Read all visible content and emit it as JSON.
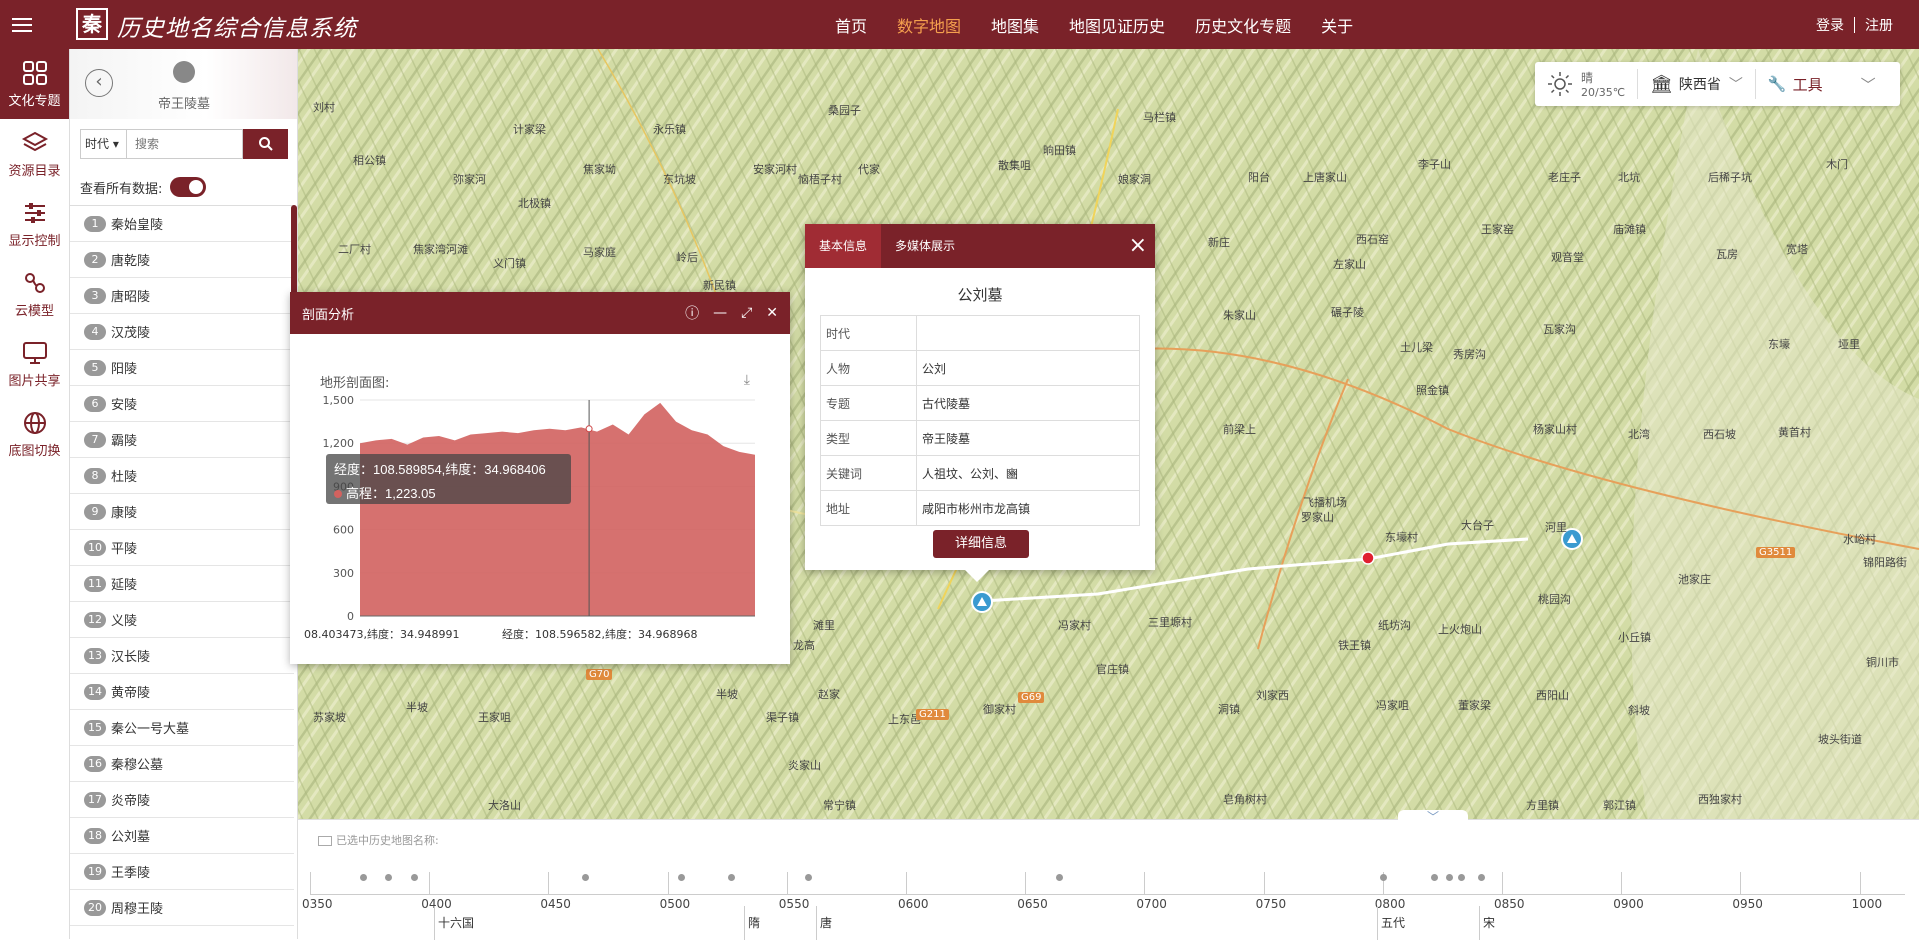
{
  "app": {
    "title": "历史地名综合信息系统",
    "logo_char": "秦"
  },
  "nav": {
    "items": [
      "首页",
      "数字地图",
      "地图集",
      "地图见证历史",
      "历史文化专题",
      "关于"
    ],
    "active": "数字地图"
  },
  "auth": {
    "login": "登录",
    "register": "注册"
  },
  "sidenav": {
    "items": [
      {
        "label": "文化专题",
        "icon": "grid-icon",
        "active": true
      },
      {
        "label": "资源目录",
        "icon": "layers-icon"
      },
      {
        "label": "显示控制",
        "icon": "sliders-icon"
      },
      {
        "label": "云模型",
        "icon": "cloud-model-icon"
      },
      {
        "label": "图片共享",
        "icon": "image-share-icon"
      },
      {
        "label": "底图切换",
        "icon": "globe-icon"
      }
    ]
  },
  "panel": {
    "title": "帝王陵墓",
    "era_select": "时代",
    "search_placeholder": "搜索",
    "view_all_label": "查看所有数据:",
    "items": [
      {
        "n": "1",
        "name": "秦始皇陵"
      },
      {
        "n": "2",
        "name": "唐乾陵"
      },
      {
        "n": "3",
        "name": "唐昭陵"
      },
      {
        "n": "4",
        "name": "汉茂陵"
      },
      {
        "n": "5",
        "name": "阳陵"
      },
      {
        "n": "6",
        "name": "安陵"
      },
      {
        "n": "7",
        "name": "霸陵"
      },
      {
        "n": "8",
        "name": "杜陵"
      },
      {
        "n": "9",
        "name": "康陵"
      },
      {
        "n": "10",
        "name": "平陵"
      },
      {
        "n": "11",
        "name": "延陵"
      },
      {
        "n": "12",
        "name": "义陵"
      },
      {
        "n": "13",
        "name": "汉长陵"
      },
      {
        "n": "14",
        "name": "黄帝陵"
      },
      {
        "n": "15",
        "name": "秦公一号大墓"
      },
      {
        "n": "16",
        "name": "秦穆公墓"
      },
      {
        "n": "17",
        "name": "炎帝陵"
      },
      {
        "n": "18",
        "name": "公刘墓"
      },
      {
        "n": "19",
        "name": "王季陵"
      },
      {
        "n": "20",
        "name": "周穆王陵"
      }
    ]
  },
  "weather": {
    "condition": "晴",
    "temp": "20/35℃",
    "province": "陕西省",
    "tools": "工具"
  },
  "profile": {
    "title": "剖面分析",
    "subtitle": "地形剖面图:",
    "tooltip_coord": "经度：108.589854,纬度：34.968406",
    "tooltip_height": "高程：1,223.05",
    "x_start": "08.403473,纬度：34.948991",
    "x_mid": "经度：108.596582,纬度：34.968968"
  },
  "chart_data": {
    "type": "area",
    "title": "地形剖面图:",
    "ylim": [
      0,
      1500
    ],
    "yticks": [
      "0",
      "300",
      "600",
      "900",
      "1,200",
      "1,500"
    ],
    "x": [
      0,
      4,
      8,
      12,
      16,
      20,
      24,
      28,
      32,
      36,
      40,
      44,
      48,
      52,
      56,
      60,
      64,
      68,
      72,
      76,
      80,
      84,
      88,
      92,
      96,
      100
    ],
    "values": [
      1200,
      1220,
      1230,
      1190,
      1240,
      1250,
      1220,
      1260,
      1270,
      1280,
      1270,
      1290,
      1300,
      1290,
      1310,
      1280,
      1330,
      1260,
      1400,
      1480,
      1350,
      1290,
      1260,
      1180,
      1140,
      1120
    ],
    "color": "#d2625f"
  },
  "popup": {
    "tabs": [
      "基本信息",
      "多媒体展示"
    ],
    "title": "公刘墓",
    "rows": [
      {
        "k": "时代",
        "v": ""
      },
      {
        "k": "人物",
        "v": "公刘"
      },
      {
        "k": "专题",
        "v": "古代陵墓"
      },
      {
        "k": "类型",
        "v": "帝王陵墓"
      },
      {
        "k": "关键词",
        "v": "人祖坟、公刘、豳"
      },
      {
        "k": "地址",
        "v": "咸阳市彬州市龙高镇"
      }
    ],
    "button": "详细信息"
  },
  "map_labels": [
    [
      "计家梁",
      215,
      22
    ],
    [
      "永乐镇",
      355,
      22
    ],
    [
      "桑园子",
      530,
      3
    ],
    [
      "马栏镇",
      845,
      10
    ],
    [
      "刘村",
      15,
      0
    ],
    [
      "相公镇",
      55,
      53
    ],
    [
      "弥家河",
      155,
      72
    ],
    [
      "东坑坡",
      365,
      72
    ],
    [
      "焦家坳",
      285,
      62
    ],
    [
      "安家河村",
      455,
      62
    ],
    [
      "代家",
      560,
      62
    ],
    [
      "散集咀",
      700,
      58
    ],
    [
      "晌田镇",
      745,
      43
    ],
    [
      "娘家洞",
      820,
      72
    ],
    [
      "阳台",
      950,
      70
    ],
    [
      "上唐家山",
      1005,
      70
    ],
    [
      "李子山",
      1120,
      57
    ],
    [
      "老庄子",
      1250,
      70
    ],
    [
      "北坑",
      1320,
      70
    ],
    [
      "后稀子坑",
      1410,
      70
    ],
    [
      "木门",
      1528,
      57
    ],
    [
      "北极镇",
      220,
      96
    ],
    [
      "恼梧子村",
      500,
      72
    ],
    [
      "二厂村",
      40,
      142
    ],
    [
      "焦家湾河滩",
      115,
      142
    ],
    [
      "马家庭",
      285,
      145
    ],
    [
      "岭后",
      378,
      150
    ],
    [
      "义门镇",
      195,
      156
    ],
    [
      "新民镇",
      405,
      178
    ],
    [
      "新庄",
      910,
      135
    ],
    [
      "西石窑",
      1058,
      132
    ],
    [
      "王家窑",
      1183,
      122
    ],
    [
      "观音堂",
      1253,
      150
    ],
    [
      "庙滩镇",
      1315,
      122
    ],
    [
      "左家山",
      1035,
      157
    ],
    [
      "瓦房",
      1418,
      147
    ],
    [
      "宽塔",
      1488,
      142
    ],
    [
      "朱家山",
      925,
      208
    ],
    [
      "碾子陵",
      1033,
      205
    ],
    [
      "土儿梁",
      1102,
      240
    ],
    [
      "秀房沟",
      1155,
      247
    ],
    [
      "瓦家沟",
      1245,
      222
    ],
    [
      "东壕",
      1470,
      237
    ],
    [
      "垭里",
      1540,
      237
    ],
    [
      "照金镇",
      1118,
      283
    ],
    [
      "前梁上",
      925,
      322
    ],
    [
      "杨家山村",
      1235,
      322
    ],
    [
      "北湾",
      1330,
      327
    ],
    [
      "西石坡",
      1405,
      327
    ],
    [
      "黄首村",
      1480,
      325
    ],
    [
      "罗家山",
      1003,
      410
    ],
    [
      "东壕村",
      1087,
      430
    ],
    [
      "大台子",
      1163,
      418
    ],
    [
      "河里",
      1247,
      420
    ],
    [
      "水峪村",
      1545,
      432
    ],
    [
      "滩里",
      515,
      518
    ],
    [
      "冯家村",
      760,
      518
    ],
    [
      "三里塬村",
      850,
      515
    ],
    [
      "纸坊沟",
      1080,
      518
    ],
    [
      "上火炮山",
      1140,
      522
    ],
    [
      "桃园沟",
      1240,
      492
    ],
    [
      "池家庄",
      1380,
      472
    ],
    [
      "锦阳路街",
      1565,
      455
    ],
    [
      "小丘镇",
      1320,
      530
    ],
    [
      "铁王镇",
      1040,
      538
    ],
    [
      "官庄镇",
      798,
      562
    ],
    [
      "刘家西",
      958,
      588
    ],
    [
      "冯家咀",
      1078,
      598
    ],
    [
      "西阳山",
      1238,
      588
    ],
    [
      "董家梁",
      1160,
      598
    ],
    [
      "铜川市",
      1568,
      555
    ],
    [
      "赵家",
      520,
      587
    ],
    [
      "半坡",
      418,
      587
    ],
    [
      "苏家坡",
      15,
      610
    ],
    [
      "半坡",
      108,
      600
    ],
    [
      "王家咀",
      180,
      610
    ],
    [
      "渠子镇",
      468,
      610
    ],
    [
      "上东邑",
      590,
      612
    ],
    [
      "御家村",
      685,
      602
    ],
    [
      "洞镇",
      920,
      602
    ],
    [
      "斜坡",
      1330,
      603
    ],
    [
      "坡头街道",
      1520,
      632
    ],
    [
      "炎家山",
      490,
      658
    ],
    [
      "大洛山",
      190,
      698
    ],
    [
      "常宁镇",
      525,
      698
    ],
    [
      "皂角树村",
      925,
      692
    ],
    [
      "方里镇",
      1228,
      698
    ],
    [
      "郭江镇",
      1305,
      698
    ],
    [
      "西独家村",
      1400,
      692
    ],
    [
      "飞播机场",
      1005,
      395
    ],
    [
      "龙高",
      495,
      538
    ]
  ],
  "road_labels": [
    [
      "G3511",
      765,
      335
    ],
    [
      "G3511",
      1458,
      498
    ],
    [
      "G70",
      288,
      620
    ],
    [
      "G211",
      618,
      660
    ],
    [
      "G69",
      720,
      643
    ]
  ],
  "timeline": {
    "label": "已选中历史地图名称:",
    "ticks": [
      "0350",
      "0400",
      "0450",
      "0500",
      "0550",
      "0600",
      "0650",
      "0700",
      "0750",
      "0800",
      "0850",
      "0900",
      "0950",
      "1000"
    ],
    "eras": [
      [
        "十六国",
        140
      ],
      [
        "隋",
        450
      ],
      [
        "唐",
        522
      ],
      [
        "五代",
        1083
      ],
      [
        "宋",
        1185
      ]
    ],
    "dots": [
      62,
      87,
      113,
      284,
      380,
      430,
      507,
      758,
      1082,
      1133,
      1148,
      1160,
      1180
    ]
  }
}
